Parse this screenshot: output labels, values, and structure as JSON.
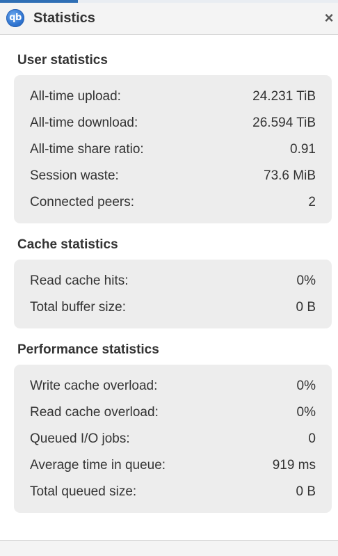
{
  "window": {
    "title": "Statistics",
    "app_icon_text": "qb",
    "close_glyph": "×"
  },
  "user_statistics": {
    "heading": "User statistics",
    "rows": [
      {
        "label": "All-time upload:",
        "value": "24.231 TiB"
      },
      {
        "label": "All-time download:",
        "value": "26.594 TiB"
      },
      {
        "label": "All-time share ratio:",
        "value": "0.91"
      },
      {
        "label": "Session waste:",
        "value": "73.6 MiB"
      },
      {
        "label": "Connected peers:",
        "value": "2"
      }
    ]
  },
  "cache_statistics": {
    "heading": "Cache statistics",
    "rows": [
      {
        "label": "Read cache hits:",
        "value": "0%"
      },
      {
        "label": "Total buffer size:",
        "value": "0 B"
      }
    ]
  },
  "performance_statistics": {
    "heading": "Performance statistics",
    "rows": [
      {
        "label": "Write cache overload:",
        "value": "0%"
      },
      {
        "label": "Read cache overload:",
        "value": "0%"
      },
      {
        "label": "Queued I/O jobs:",
        "value": "0"
      },
      {
        "label": "Average time in queue:",
        "value": "919 ms"
      },
      {
        "label": "Total queued size:",
        "value": "0 B"
      }
    ]
  },
  "colors": {
    "panel_background": "#ededed",
    "titlebar_background": "#f4f4f4",
    "app_icon_blue": "#2f74d0"
  }
}
